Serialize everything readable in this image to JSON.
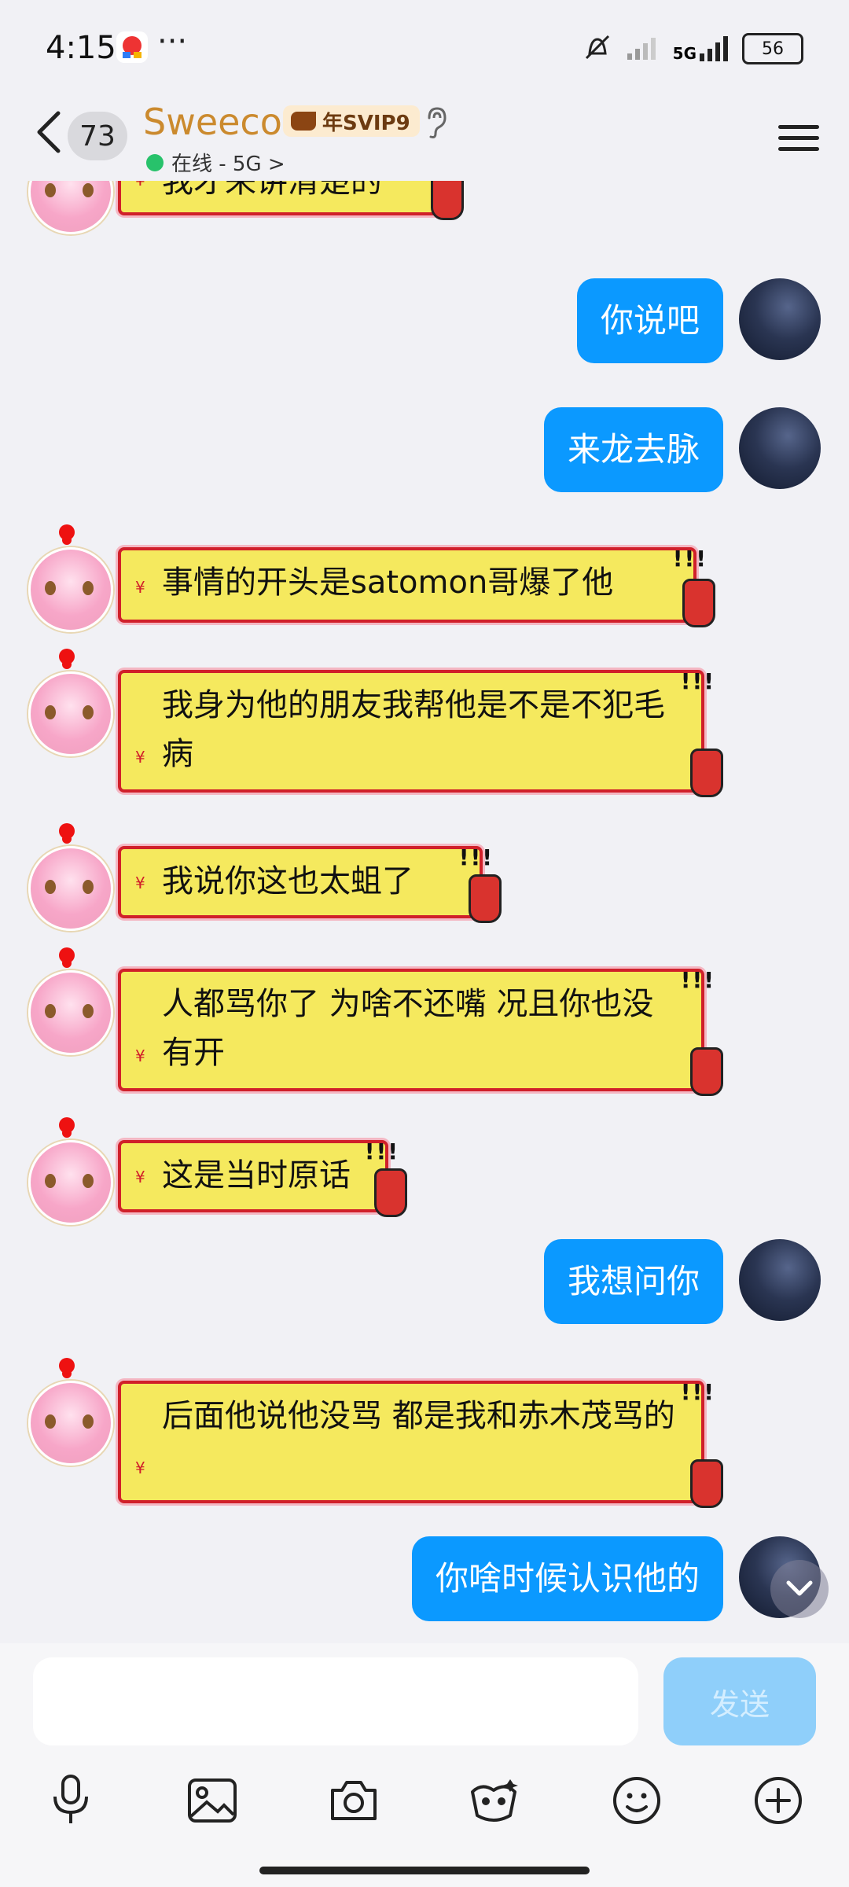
{
  "status_bar": {
    "time": "4:15",
    "dots": "···",
    "network": "5G",
    "battery": "56"
  },
  "header": {
    "back_icon": "chevron-left-icon",
    "unread_count": "73",
    "contact_name": "Sweeco",
    "vip_badge": "年SVIP9",
    "presence_text": "在线 - 5G >",
    "menu_icon": "hamburger-menu-icon"
  },
  "messages": [
    {
      "from": "other",
      "text": "我才来讲清楚的"
    },
    {
      "from": "me",
      "text": "你说吧"
    },
    {
      "from": "me",
      "text": "来龙去脉"
    },
    {
      "from": "other",
      "text": "事情的开头是satomon哥爆了他"
    },
    {
      "from": "other",
      "text": "我身为他的朋友我帮他是不是不犯毛病"
    },
    {
      "from": "other",
      "text": "我说你这也太蛆了"
    },
    {
      "from": "other",
      "text": "人都骂你了 为啥不还嘴 况且你也没有开"
    },
    {
      "from": "other",
      "text": "这是当时原话"
    },
    {
      "from": "me",
      "text": "我想问你"
    },
    {
      "from": "other",
      "text": "后面他说他没骂 都是我和赤木茂骂的"
    },
    {
      "from": "me",
      "text": "你啥时候认识他的"
    }
  ],
  "composer": {
    "input_placeholder": "",
    "send_label": "发送"
  },
  "toolbar": {
    "icons": [
      "microphone-icon",
      "image-icon",
      "camera-icon",
      "red-packet-icon",
      "emoji-icon",
      "plus-icon"
    ]
  },
  "colors": {
    "self_bubble": "#0B99FF",
    "other_bubble": "#F5E95E",
    "other_bubble_border": "#D0202A",
    "background": "#F1F1F5",
    "send_disabled": "#8FCFFA"
  }
}
